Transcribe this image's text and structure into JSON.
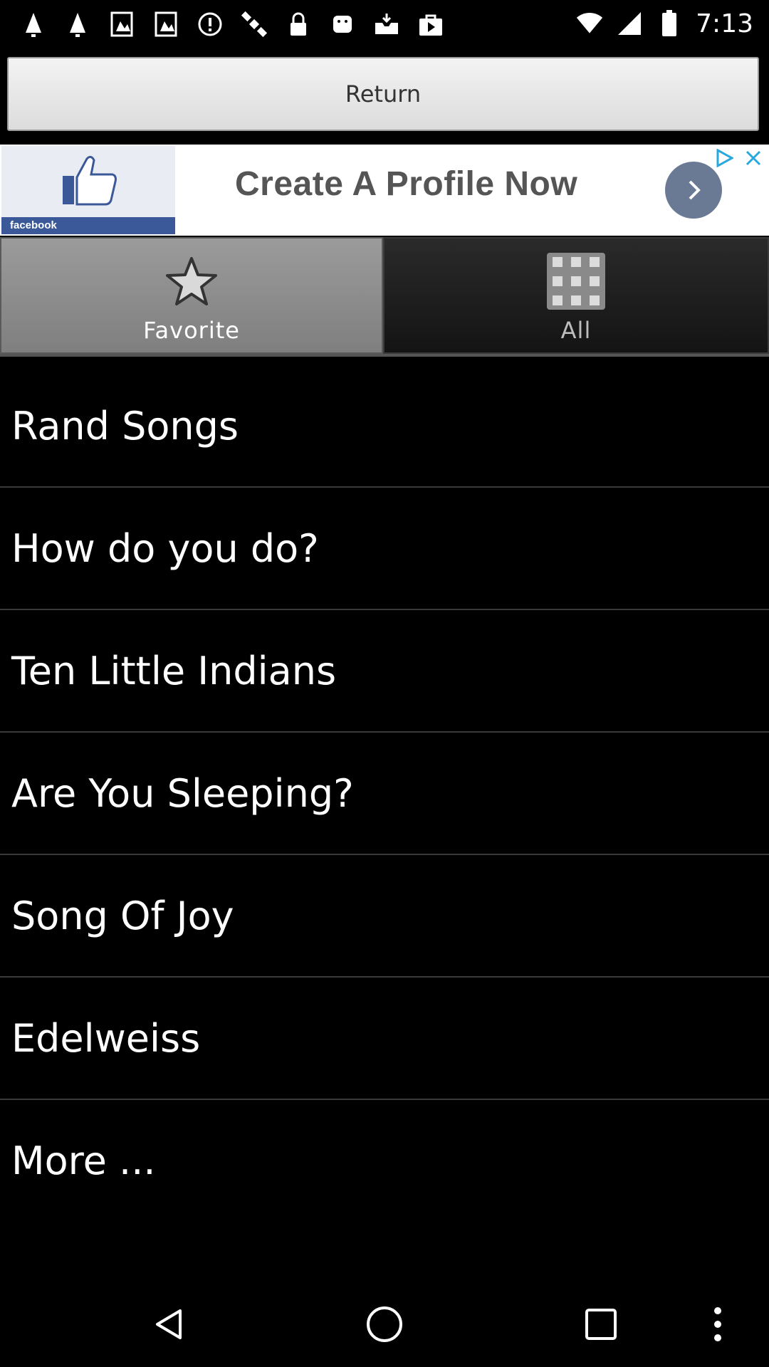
{
  "status_bar": {
    "time": "7:13",
    "left_icons": [
      "notification-icon",
      "notification-icon",
      "image-icon",
      "image-icon",
      "alert-icon",
      "satellite-icon",
      "lock-icon",
      "android-icon",
      "inbox-icon",
      "store-icon"
    ],
    "right_icons": [
      "wifi-icon",
      "signal-icon",
      "battery-icon"
    ]
  },
  "return_button": {
    "label": "Return"
  },
  "ad": {
    "brand": "facebook",
    "text": "Create A Profile Now"
  },
  "tabs": [
    {
      "label": "Favorite",
      "icon": "star-icon",
      "active": true
    },
    {
      "label": "All",
      "icon": "grid-icon",
      "active": false
    }
  ],
  "songs": [
    {
      "title": "Rand Songs"
    },
    {
      "title": "How do you do?"
    },
    {
      "title": "Ten Little Indians"
    },
    {
      "title": "Are You Sleeping?"
    },
    {
      "title": "Song Of Joy"
    },
    {
      "title": "Edelweiss"
    },
    {
      "title": "More ..."
    }
  ],
  "colors": {
    "background": "#000000",
    "tab_active": "#8c8c8c",
    "tab_inactive": "#1e1e1e",
    "ad_button": "#6a7a95",
    "facebook_blue": "#3b5998"
  },
  "nav_icons": [
    "back-icon",
    "home-icon",
    "recents-icon",
    "overflow-menu-icon"
  ]
}
